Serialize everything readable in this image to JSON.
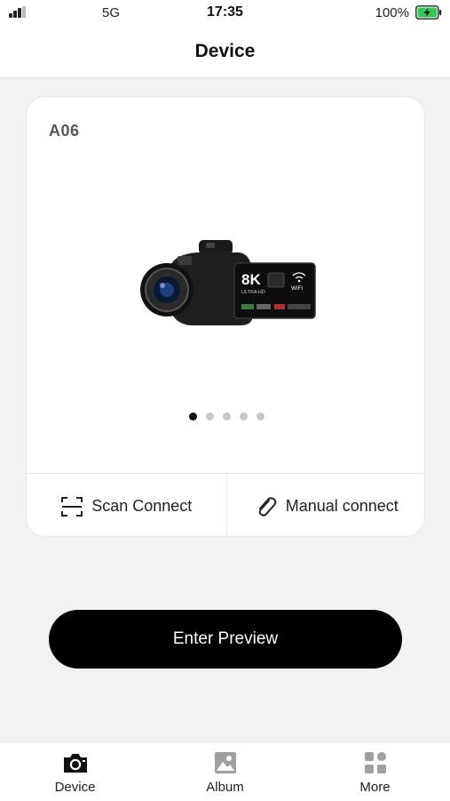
{
  "status_bar": {
    "network": "5G",
    "time": "17:35",
    "battery": "100%",
    "icons": [
      "signal-icon",
      "battery-charging-icon"
    ]
  },
  "header": {
    "title": "Device"
  },
  "device_card": {
    "model": "A06",
    "image": "camcorder-image",
    "carousel": {
      "count": 5,
      "active_index": 0
    },
    "actions": [
      {
        "label": "Scan Connect",
        "icon": "scan-icon"
      },
      {
        "label": "Manual connect",
        "icon": "paperclip-icon"
      }
    ]
  },
  "primary_button": {
    "label": "Enter Preview"
  },
  "tab_bar": {
    "items": [
      {
        "label": "Device",
        "icon": "camera-icon",
        "active": true
      },
      {
        "label": "Album",
        "icon": "image-icon",
        "active": false
      },
      {
        "label": "More",
        "icon": "grid-icon",
        "active": false
      }
    ]
  },
  "colors": {
    "background": "#f2f2f2",
    "card": "#ffffff",
    "primary_button": "#000000",
    "text": "#1a1a1a",
    "inactive_icon": "#9a9a9a"
  }
}
